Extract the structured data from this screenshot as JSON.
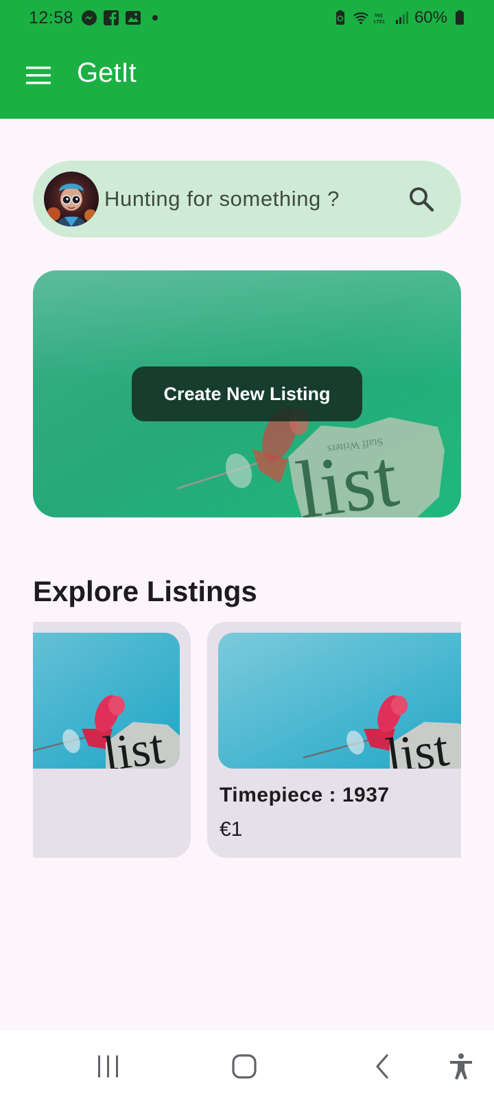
{
  "status_bar": {
    "time": "12:58",
    "battery": "60%",
    "left_icons": [
      "messenger-icon",
      "facebook-icon",
      "gallery-icon",
      "dot-icon"
    ],
    "right_icons": [
      "battery-saver-icon",
      "wifi-icon",
      "volte-icon",
      "signal-icon",
      "battery-icon"
    ]
  },
  "app_bar": {
    "title": "GetIt",
    "menu_icon": "hamburger-menu-icon",
    "background": "#1bb044"
  },
  "search": {
    "placeholder": "Hunting for something ?",
    "value": "",
    "icon": "search-icon",
    "background": "#cfebd6"
  },
  "banner": {
    "button_label": "Create New Listing"
  },
  "explore": {
    "title": "Explore Listings",
    "cards": [
      {
        "title": "",
        "price": ""
      },
      {
        "title": "Timepiece : 1937",
        "price": "€1"
      }
    ]
  },
  "nav_bar": {
    "icons": [
      "recent-apps-icon",
      "home-icon",
      "back-icon",
      "accessibility-icon"
    ]
  }
}
